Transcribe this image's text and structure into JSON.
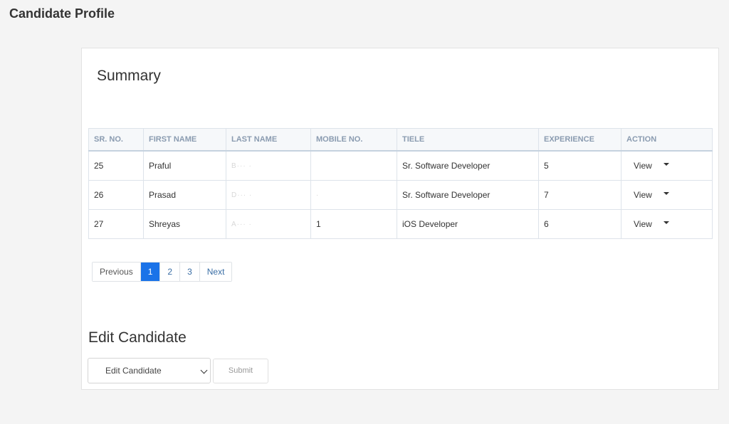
{
  "page": {
    "title": "Candidate Profile"
  },
  "summary": {
    "title": "Summary",
    "columns": [
      "SR. NO.",
      "FIRST NAME",
      "LAST NAME",
      "MOBILE NO.",
      "TIELE",
      "EXPERIENCE",
      "ACTION"
    ],
    "rows": [
      {
        "sr": "25",
        "first": "Praful",
        "last": "B··· ·",
        "mobile": "",
        "title": "Sr. Software Developer",
        "experience": "5",
        "action": "View"
      },
      {
        "sr": "26",
        "first": "Prasad",
        "last": "D··· ·",
        "mobile": "·",
        "title": "Sr. Software Developer",
        "experience": "7",
        "action": "View"
      },
      {
        "sr": "27",
        "first": "Shreyas",
        "last": "A··· ·",
        "mobile": "1",
        "title": "iOS Developer",
        "experience": "6",
        "action": "View"
      }
    ]
  },
  "pagination": {
    "previous": "Previous",
    "pages": [
      "1",
      "2",
      "3"
    ],
    "next": "Next",
    "active": "1"
  },
  "edit": {
    "title": "Edit Candidate",
    "select_value": "Edit Candidate",
    "submit": "Submit"
  },
  "colors": {
    "accent": "#1a73e8",
    "header_text": "#8a9bb0"
  }
}
